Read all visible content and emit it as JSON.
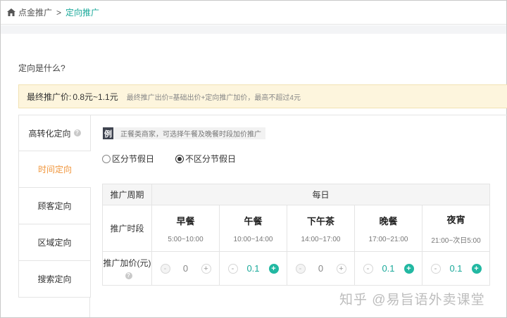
{
  "breadcrumb": {
    "home": "点金推广",
    "separator": ">",
    "current": "定向推广"
  },
  "intro_link": "定向是什么?",
  "price_bar": {
    "label": "最终推广价:",
    "value": "0.8元~1.1元",
    "note": "最终推广出价=基础出价+定向推广加价，最高不超过4元"
  },
  "tabs": [
    {
      "label": "高转化定向",
      "help": "?"
    },
    {
      "label": "时间定向"
    },
    {
      "label": "顾客定向"
    },
    {
      "label": "区域定向"
    },
    {
      "label": "搜索定向"
    }
  ],
  "example": {
    "badge": "例",
    "text": "正餐类商家，可选择午餐及晚餐时段加价推广"
  },
  "radios": [
    {
      "label": "区分节假日",
      "checked": false
    },
    {
      "label": "不区分节假日",
      "checked": true
    }
  ],
  "table": {
    "col_period": "推广周期",
    "period_value": "每日",
    "row_time": "推广时段",
    "row_price": "推广加价(元)",
    "help": "?",
    "meals": [
      {
        "name": "早餐",
        "time": "5:00~10:00",
        "value": "0"
      },
      {
        "name": "午餐",
        "time": "10:00~14:00",
        "value": "0.1"
      },
      {
        "name": "下午茶",
        "time": "14:00~17:00",
        "value": "0"
      },
      {
        "name": "晚餐",
        "time": "17:00~21:00",
        "value": "0.1"
      },
      {
        "name": "夜宵",
        "time": "21:00~次日5:00",
        "value": "0.1"
      }
    ],
    "minus": "-",
    "plus": "+"
  },
  "watermark": "知乎 @易旨语外卖课堂",
  "colors": {
    "accent": "#1aa99a",
    "active_tab": "#f0953a",
    "notice_bg": "#fdf5dd"
  }
}
